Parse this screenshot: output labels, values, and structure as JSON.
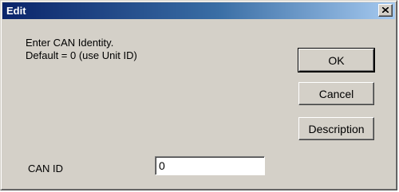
{
  "window": {
    "title": "Edit"
  },
  "prompt": {
    "line1": "Enter CAN Identity.",
    "line2": "Default = 0 (use Unit ID)"
  },
  "buttons": {
    "ok": "OK",
    "cancel": "Cancel",
    "description": "Description"
  },
  "can_id": {
    "label": "CAN ID",
    "value": "0"
  },
  "icons": {
    "close": "close-icon"
  },
  "colors": {
    "titlebar_start": "#0a246a",
    "titlebar_end": "#a6caf0",
    "face": "#d4d0c8"
  }
}
